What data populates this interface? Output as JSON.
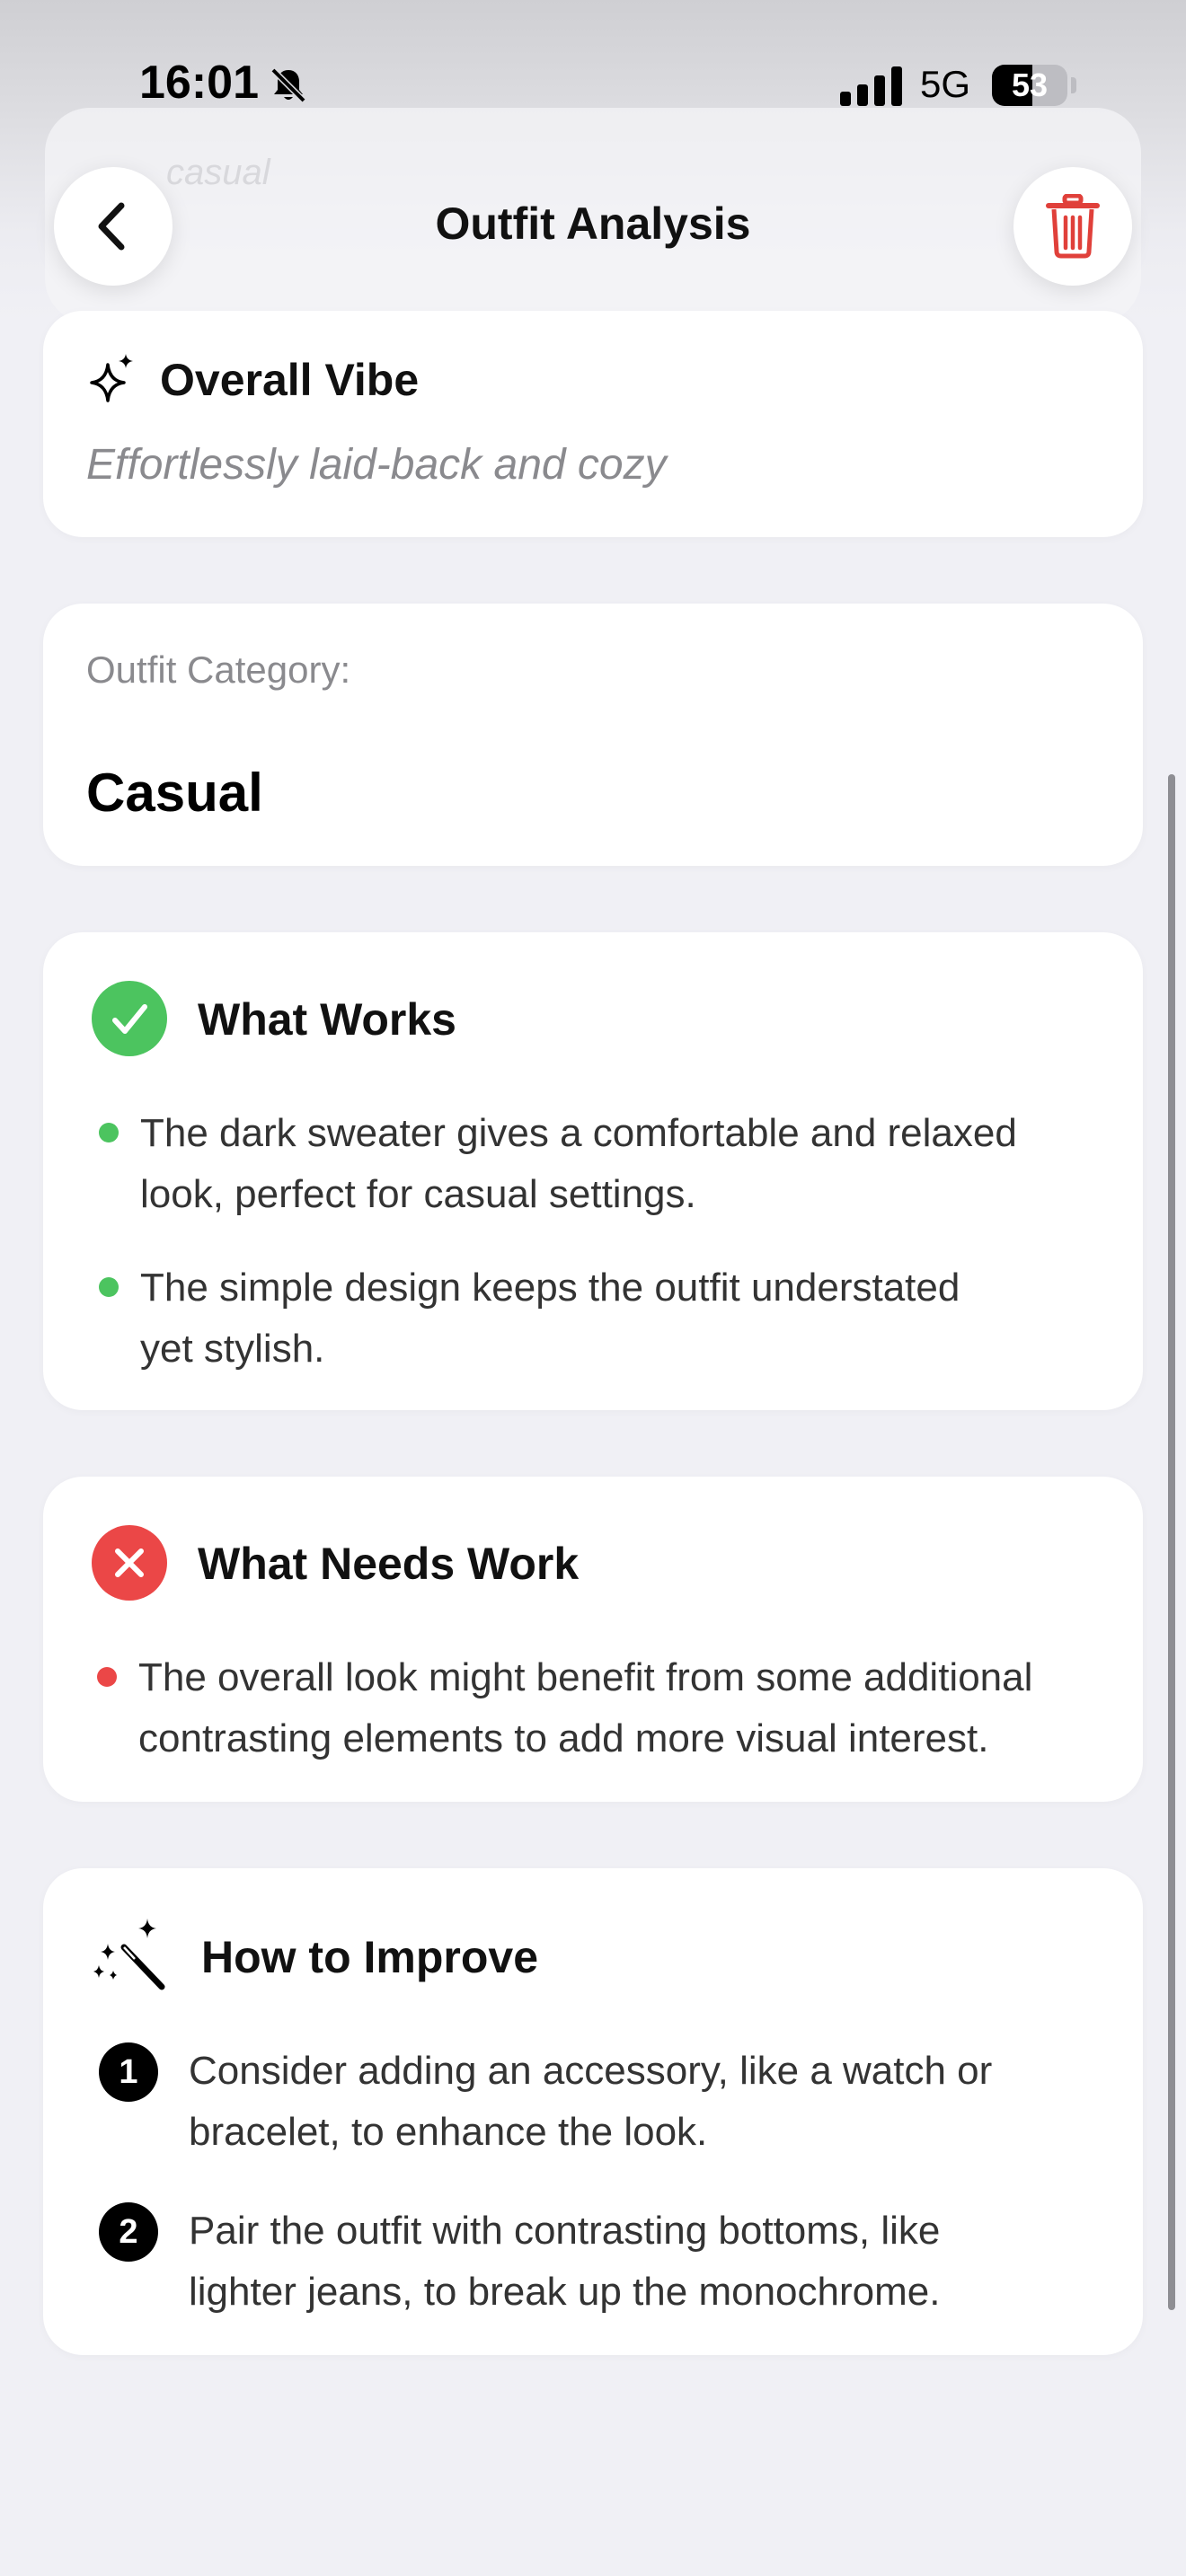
{
  "status_bar": {
    "time": "16:01",
    "network": "5G",
    "battery": "53",
    "battery_level_percent": 53,
    "icons": [
      "bell-slash-icon",
      "cellular-signal-icon",
      "battery-icon"
    ]
  },
  "background": {
    "ghost_text": "casual"
  },
  "nav": {
    "title": "Outfit Analysis",
    "back_icon": "chevron-left-icon",
    "delete_icon": "trash-icon"
  },
  "vibe": {
    "icon": "sparkles-icon",
    "title": "Overall Vibe",
    "subtitle": "Effortlessly laid-back and cozy"
  },
  "category": {
    "label": "Outfit Category:",
    "value": "Casual"
  },
  "works": {
    "icon": "checkmark-circle-icon",
    "title": "What Works",
    "items": [
      {
        "line1": "The dark sweater gives a comfortable and relaxed",
        "line2": "look, perfect for casual settings."
      },
      {
        "line1": "The simple design keeps the outfit understated",
        "line2": "yet stylish."
      }
    ]
  },
  "needs": {
    "icon": "x-circle-icon",
    "title": "What Needs Work",
    "items": [
      {
        "line1": "The overall look might benefit from some additional",
        "line2": "contrasting elements to add more visual interest."
      }
    ]
  },
  "improve": {
    "icon": "magic-wand-icon",
    "title": "How to Improve",
    "items": [
      {
        "num": "1",
        "line1": "Consider adding an accessory, like a watch or",
        "line2": "bracelet, to enhance the look."
      },
      {
        "num": "2",
        "line1": "Pair the outfit with contrasting bottoms, like",
        "line2": "lighter jeans, to break up the monochrome."
      }
    ]
  },
  "colors": {
    "accent_green": "#4cc45f",
    "accent_red": "#eb4747",
    "delete_red": "#e0403a",
    "background": "#f0f0f5"
  }
}
